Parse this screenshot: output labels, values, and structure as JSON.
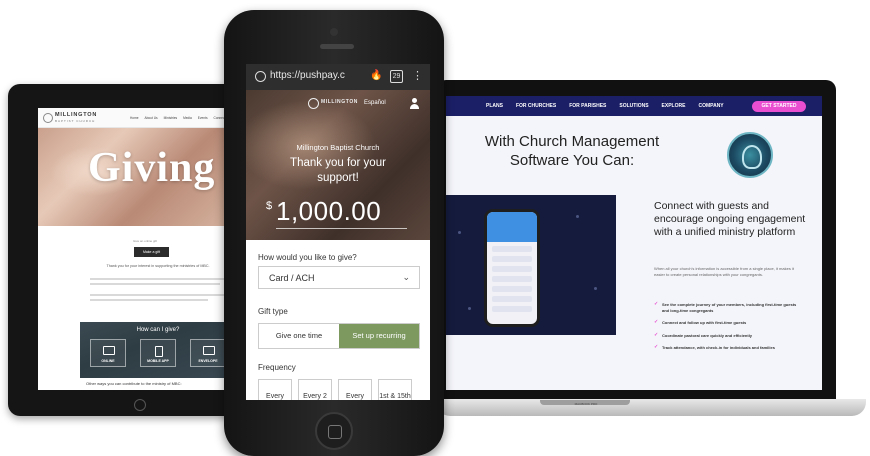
{
  "tablet": {
    "logo_text": "MILLINGTON",
    "logo_sub": "BAPTIST CHURCH",
    "nav": [
      "Home",
      "About Us",
      "Ministries",
      "Media",
      "Events",
      "Connect",
      "Give"
    ],
    "hero_title": "Giving",
    "small_text": "Give an online gift",
    "button_label": "Make a gift",
    "thanks_text": "Thank you for your interest in supporting the ministries of MBC.",
    "panel_title": "How can I give?",
    "cards": [
      {
        "label": "ONLINE",
        "icon": "laptop-icon"
      },
      {
        "label": "MOBILE APP",
        "icon": "phone-icon"
      },
      {
        "label": "ENVELOPE",
        "icon": "envelope-icon"
      }
    ],
    "footer_text": "Other ways you can contribute to the ministry of MBC:"
  },
  "phone": {
    "url": "https://pushpay.c",
    "tab_count": "29",
    "logo_text": "MILLINGTON",
    "espanol": "Español",
    "church_name": "Millington Baptist Church",
    "thanks": "Thank you for your support!",
    "currency": "$",
    "amount": "1,000.00",
    "q_how": "How would you like to give?",
    "payment_method": "Card / ACH",
    "gift_type_label": "Gift type",
    "gift_option_one": "Give one time",
    "gift_option_recurring": "Set up recurring",
    "frequency_label": "Frequency",
    "frequency_options": [
      "Every",
      "Every 2",
      "Every",
      "1st & 15th"
    ],
    "colors": {
      "recurring_selected": "#7d9960",
      "urlbar": "#2e2e2e"
    }
  },
  "laptop": {
    "nav": [
      "PLANS",
      "FOR CHURCHES",
      "FOR PARISHES",
      "SOLUTIONS",
      "EXPLORE",
      "COMPANY"
    ],
    "cta": "GET STARTED",
    "title": "With Church Management Software You Can:",
    "heading": "Connect with guests and encourage ongoing engagement with a unified ministry platform",
    "paragraph": "When all your church's information is accessible from a single place, it makes it easier to create personal relationships with your congregants.",
    "list": [
      "See the complete journey of your members, including first-time guests and long-time congregants",
      "Connect and follow up with first-time guests",
      "Coordinate pastoral care quickly and efficiently",
      "Track attendance, with check-in for individuals and families"
    ],
    "base_label": "MACBOOK PRO",
    "colors": {
      "nav": "#1b1f66",
      "cta": "#e94ed0"
    }
  }
}
